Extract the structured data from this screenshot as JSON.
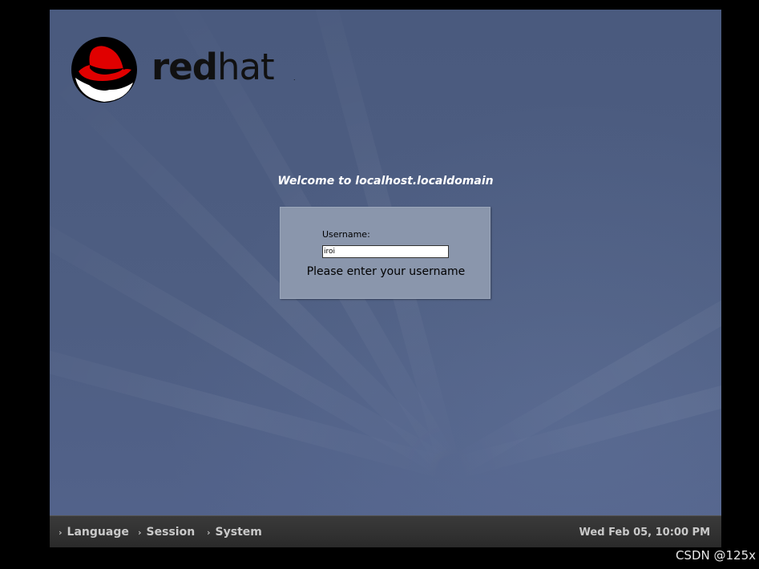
{
  "logo": {
    "wordmark_red": "red",
    "wordmark_hat": "hat",
    "trademark": "."
  },
  "welcome_text": "Welcome to localhost.localdomain",
  "login": {
    "username_label": "Username:",
    "username_value": "iroi",
    "prompt": "Please enter your username"
  },
  "taskbar": {
    "menu": [
      {
        "label": "Language",
        "icon": "chevron-right-icon"
      },
      {
        "label": "Session",
        "icon": "chevron-right-icon"
      },
      {
        "label": "System",
        "icon": "chevron-right-icon"
      }
    ],
    "clock": "Wed Feb 05, 10:00 PM"
  },
  "watermark": "CSDN @125x",
  "colors": {
    "background": "#4b5a7d",
    "login_box": "#8a96ac",
    "taskbar": "#2e2e2e",
    "hat_red": "#e00000"
  }
}
